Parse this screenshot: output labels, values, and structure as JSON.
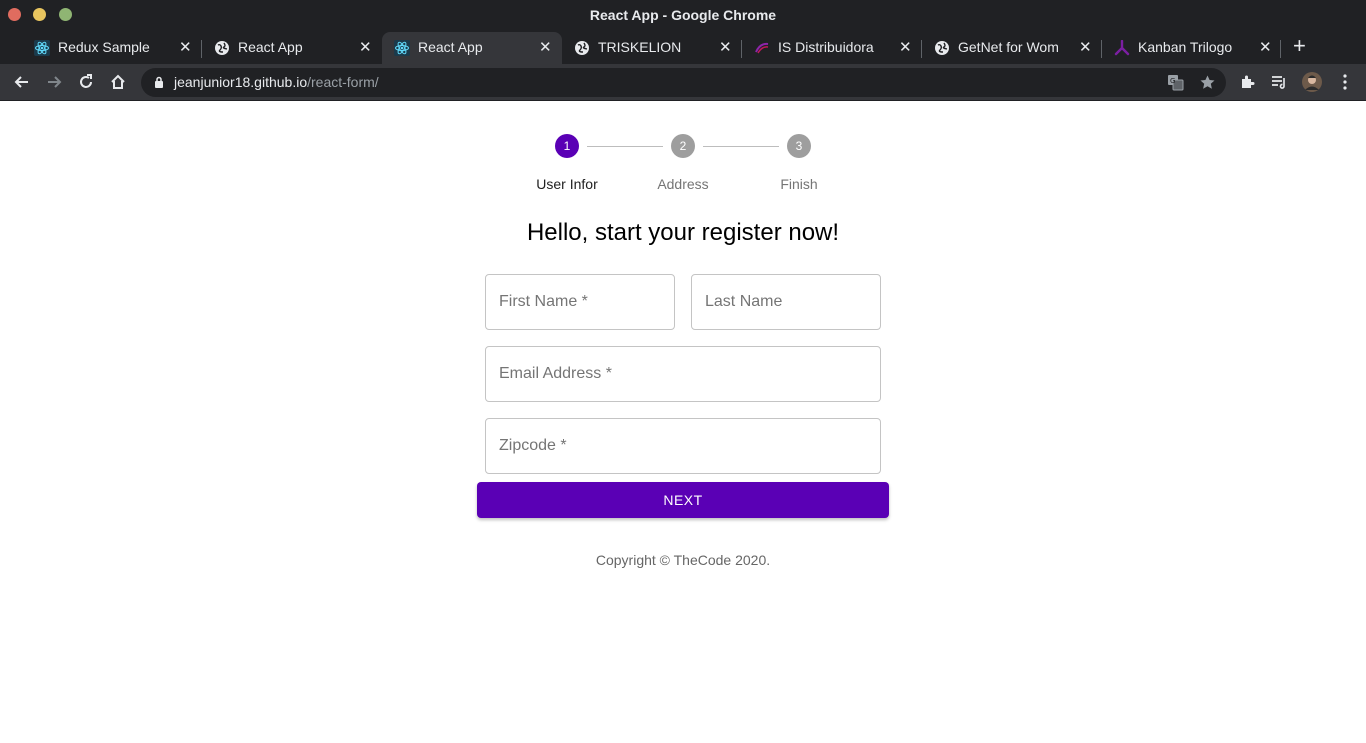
{
  "window": {
    "title": "React App - Google Chrome"
  },
  "tabs": [
    {
      "label": "Redux Sample",
      "icon": "react-icon",
      "active": false
    },
    {
      "label": "React App",
      "icon": "globe-icon",
      "active": false
    },
    {
      "label": "React App",
      "icon": "react-icon",
      "active": true
    },
    {
      "label": "TRISKELION",
      "icon": "globe-icon",
      "active": false
    },
    {
      "label": "IS Distribuidora",
      "icon": "arc-logo-icon",
      "active": false
    },
    {
      "label": "GetNet for Wom",
      "icon": "globe-icon",
      "active": false
    },
    {
      "label": "Kanban Trilogo",
      "icon": "trilogo-icon",
      "active": false
    }
  ],
  "new_tab_label": "+",
  "address_bar": {
    "domain": "jeanjunior18.github.io",
    "path": "/react-form/"
  },
  "stepper": {
    "steps": [
      {
        "number": "1",
        "label": "User Infor",
        "active": true
      },
      {
        "number": "2",
        "label": "Address",
        "active": false
      },
      {
        "number": "3",
        "label": "Finish",
        "active": false
      }
    ]
  },
  "form": {
    "heading": "Hello, start your register now!",
    "first_name_placeholder": "First Name *",
    "last_name_placeholder": "Last Name",
    "email_placeholder": "Email Address *",
    "zipcode_placeholder": "Zipcode *",
    "next_label": "NEXT"
  },
  "footer": {
    "copyright": "Copyright © TheCode 2020."
  },
  "colors": {
    "primary": "#5a00b5",
    "inactive_step": "#9e9e9e"
  }
}
